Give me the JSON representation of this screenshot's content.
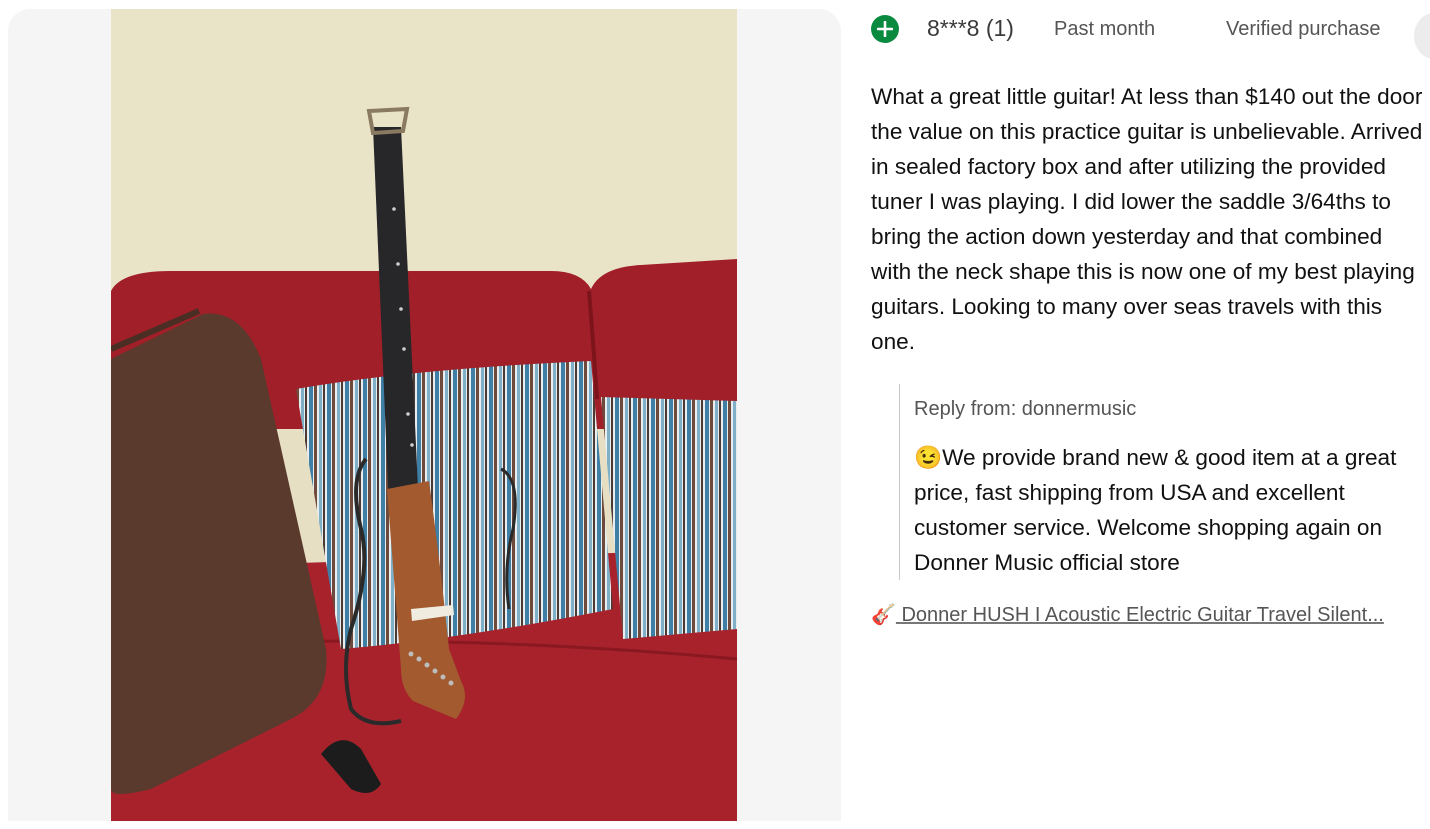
{
  "review": {
    "reviewer": "8***8 (1)",
    "when": "Past month",
    "verified": "Verified purchase",
    "text": "What a great little guitar! At less than $140 out the door the value on this practice guitar is unbelievable. Arrived in sealed factory box and after utilizing the provided tuner I was playing. I did lower the saddle 3/64ths to bring the action down yesterday and that combined with the neck shape this is now one of my best playing guitars. Looking to many over seas travels with this one."
  },
  "reply": {
    "from": "Reply from: donnermusic",
    "emoji": "😉",
    "text": "We provide brand new & good item at a great price, fast shipping from USA and excellent customer service. Welcome shopping again on Donner Music official store"
  },
  "product": {
    "icon": "🎸",
    "title": "Donner HUSH I Acoustic Electric Guitar Travel Silent..."
  },
  "icons": {
    "plus": "plus-circle-icon",
    "more": "more-options-icon"
  },
  "colors": {
    "badge": "#0a8a3e",
    "sofa": "#9d1f28",
    "wall": "#e9e3c9"
  }
}
